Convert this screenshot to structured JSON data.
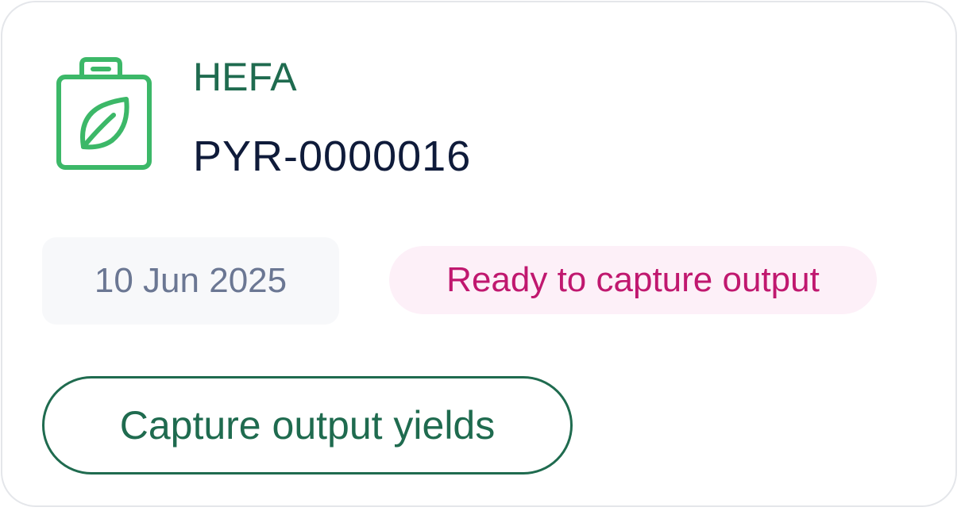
{
  "card": {
    "icon": "jerrycan-leaf-icon",
    "process_name": "HEFA",
    "batch_id": "PYR-0000016",
    "date": "10 Jun 2025",
    "status": "Ready to capture output",
    "action_label": "Capture output yields"
  },
  "colors": {
    "accent_green": "#1f6b4f",
    "icon_green": "#3cb868",
    "status_text": "#c0186f",
    "status_bg": "#fdf0f8",
    "date_text": "#6b7793",
    "date_bg": "#f7f8fa",
    "border": "#e4e6ea"
  }
}
